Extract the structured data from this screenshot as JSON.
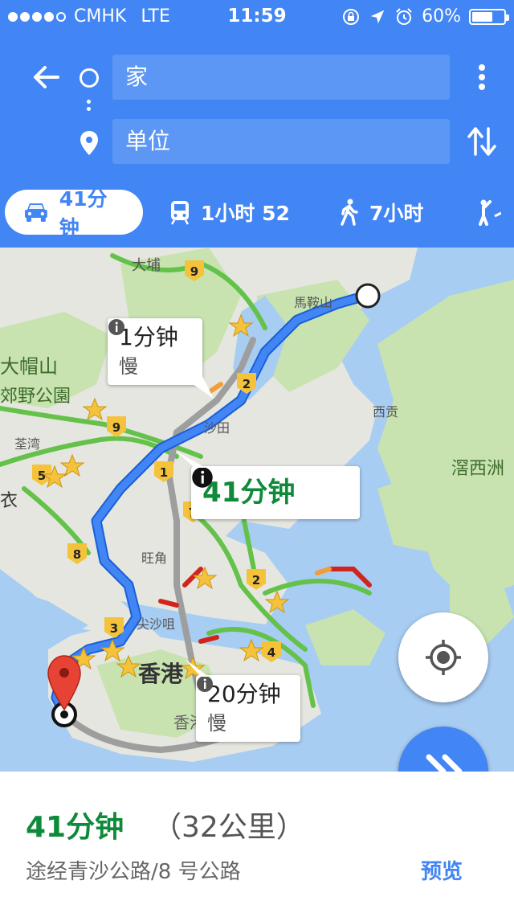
{
  "status_bar": {
    "carrier": "CMHK",
    "network": "LTE",
    "time": "11:59",
    "battery": "60%"
  },
  "search": {
    "origin": "家",
    "destination": "单位"
  },
  "modes": [
    {
      "name": "drive",
      "label": "41分钟",
      "active": true
    },
    {
      "name": "transit",
      "label": "1小时 52"
    },
    {
      "name": "walk",
      "label": "7小时"
    }
  ],
  "map": {
    "place_labels": [
      "大埔",
      "馬鞍山",
      "大帽山",
      "郊野公園",
      "荃湾",
      "沙田",
      "西贡",
      "滘西洲",
      "衣",
      "旺角",
      "尖沙咀",
      "香港",
      "香港"
    ],
    "road_numbers": [
      "9",
      "2",
      "9",
      "5",
      "1",
      "7",
      "8",
      "2",
      "3",
      "4"
    ],
    "callouts": [
      {
        "time": "1分钟",
        "sub": "慢"
      },
      {
        "time": "41分钟"
      },
      {
        "time": "20分钟",
        "sub": "慢"
      }
    ],
    "colors": {
      "water": "#a8cdf2",
      "land": "#e6e6e0",
      "green": "#c8e3b0",
      "route": "#4285f4",
      "alt_route": "#9e9e9e",
      "traffic_ok": "#64c24a",
      "traffic_slow": "#f29d38",
      "traffic_jam": "#d0251b"
    }
  },
  "summary": {
    "time": "41分钟",
    "distance": "（32公里）",
    "via": "途经青沙公路/8 号公路",
    "preview": "预览"
  }
}
